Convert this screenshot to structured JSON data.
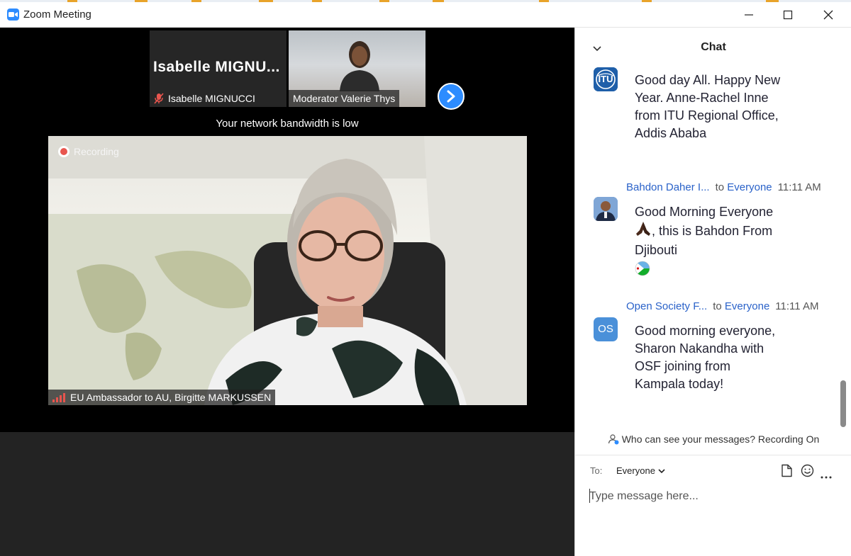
{
  "window": {
    "title": "Zoom Meeting"
  },
  "thumbnails": [
    {
      "display_name": "Isabelle  MIGNU...",
      "label": "Isabelle MIGNUCCI",
      "muted": true
    },
    {
      "display_name": "",
      "label": "Moderator Valerie Thys",
      "muted": false
    }
  ],
  "notice": {
    "bandwidth": "Your network bandwidth is low"
  },
  "main_video": {
    "recording_label": "Recording",
    "speaker_label": "EU Ambassador to AU, Birgitte MARKUSSEN"
  },
  "chat": {
    "title": "Chat",
    "messages": [
      {
        "sender": "",
        "to_word": "",
        "target": "",
        "time": "",
        "avatar": "itu-logo",
        "avatar_text": "ITU",
        "text": "Good day All. Happy New Year. Anne-Rachel Inne from ITU Regional Office, Addis Ababa"
      },
      {
        "sender": "Bahdon Daher I...",
        "to_word": "to",
        "target": "Everyone",
        "time": "11:11 AM",
        "avatar": "photo",
        "text_before": "Good Morning Everyone ",
        "text_after": ", this is Bahdon From Djibouti"
      },
      {
        "sender": "Open Society F...",
        "to_word": "to",
        "target": "Everyone",
        "time": "11:11 AM",
        "avatar": "initials",
        "avatar_text": "OS",
        "text": "Good morning everyone, Sharon Nakandha with OSF joining from Kampala today!"
      }
    ],
    "privacy_notice": "Who can see your messages? Recording On",
    "composer": {
      "to_label": "To:",
      "recipient": "Everyone",
      "placeholder": "Type message here..."
    }
  },
  "colors": {
    "accent": "#2d8cff",
    "link": "#2a62c9",
    "recording": "#e8554e",
    "signal": "#e8554e"
  }
}
